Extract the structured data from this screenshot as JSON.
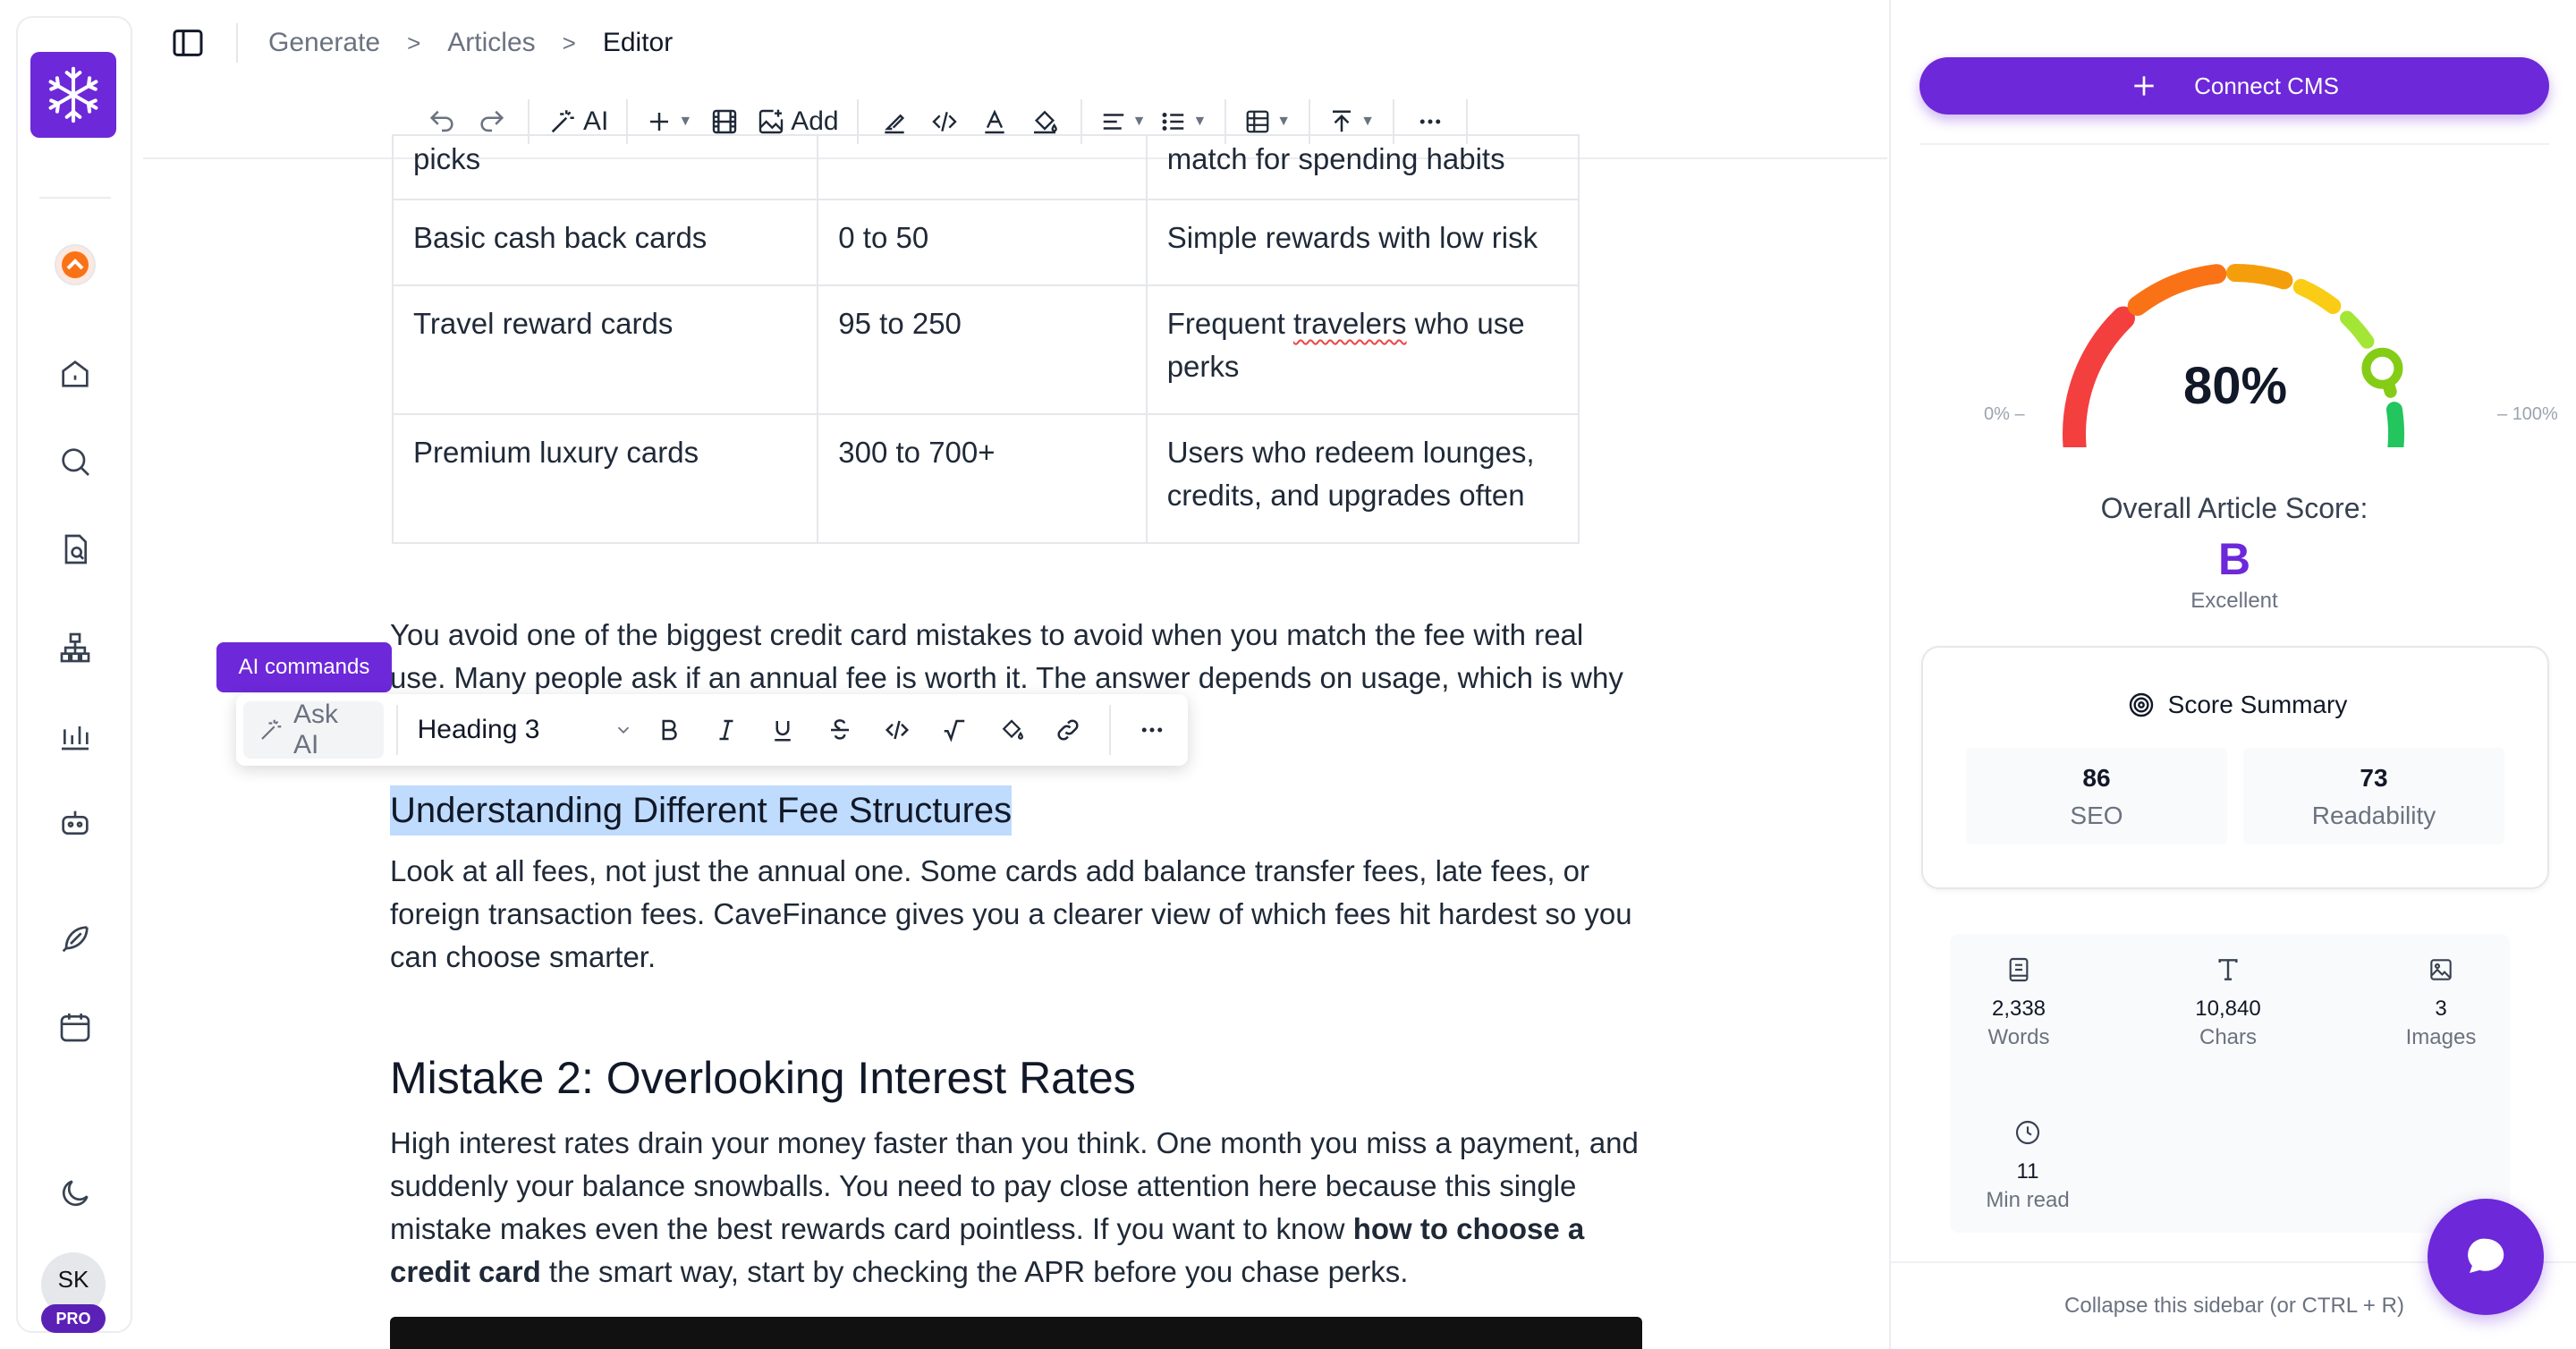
{
  "breadcrumb": {
    "items": [
      "Generate",
      "Articles",
      "Editor"
    ],
    "sep": ">"
  },
  "toolbar": {
    "ai_label": "AI",
    "add_label": "Add"
  },
  "table": {
    "rows": [
      [
        "picks",
        "",
        "match for spending habits"
      ],
      [
        "Basic cash back cards",
        "0 to 50",
        "Simple rewards with low risk"
      ],
      [
        "Travel reward cards",
        "95 to 250",
        "Frequent travelers who use perks"
      ],
      [
        "Premium luxury cards",
        "300 to 700+",
        "Users redeem lounges, credits, and upgrades often"
      ]
    ],
    "row3_col3_a": "Frequent ",
    "row3_col3_b": "travelers",
    "row3_col3_c": " who use perks",
    "row4_col3": "Users who redeem lounges, credits, and upgrades often"
  },
  "content": {
    "para1": "You avoid one of the biggest credit card mistakes to avoid when you match the fee with real use. Many people ask if an annual fee is worth it. The answer depends on usage, which is why",
    "heading3": "Understanding Different Fee Structures",
    "para2": "Look at all fees, not just the annual one. Some cards add balance transfer fees, late fees, or foreign transaction fees. CaveFinance gives you a clearer view of which fees hit hardest so you can choose smarter.",
    "heading2": "Mistake 2: Overlooking Interest Rates",
    "para3_a": "High interest rates drain your money faster than you think. One month you miss a payment, and suddenly your balance snowballs. You need to pay close attention here because this single mistake makes even the best rewards card pointless. If you want to know ",
    "para3_bold": "how to choose a credit card",
    "para3_b": " the smart way, start by checking the APR before you chase perks."
  },
  "format_bar": {
    "ai_commands_label": "AI commands",
    "ask_ai_label": "Ask AI",
    "heading_select": "Heading 3"
  },
  "sidebar": {
    "connect_label": "Connect CMS",
    "gauge": {
      "value_pct": 80,
      "display": "80%",
      "min_label": "0%",
      "max_label": "100%"
    },
    "overall_label": "Overall Article Score:",
    "grade": "B",
    "grade_desc": "Excellent",
    "summary_title": "Score Summary",
    "seo": {
      "value": "86",
      "label": "SEO"
    },
    "readability": {
      "value": "73",
      "label": "Readability"
    },
    "stats": {
      "words": {
        "value": "2,338",
        "label": "Words"
      },
      "chars": {
        "value": "10,840",
        "label": "Chars"
      },
      "images": {
        "value": "3",
        "label": "Images"
      },
      "minread": {
        "value": "11",
        "label": "Min read"
      }
    },
    "collapse_hint": "Collapse this sidebar (or CTRL + R)"
  },
  "user": {
    "initials": "SK",
    "plan": "PRO"
  },
  "colors": {
    "accent": "#6d28d9",
    "highlight": "#bfdbfe"
  }
}
